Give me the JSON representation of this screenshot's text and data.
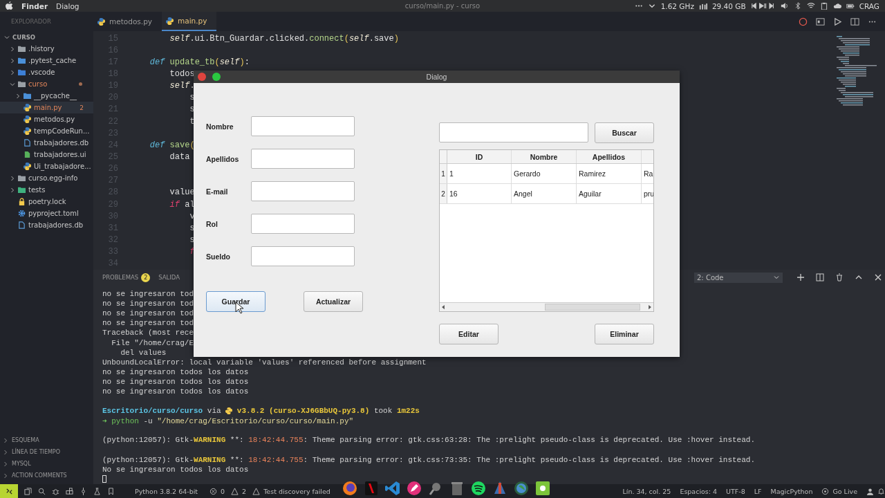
{
  "menubar": {
    "app": "Finder",
    "menus": [
      "Dialog"
    ],
    "title": "curso/main.py - curso",
    "cpu": "1.62 GHz",
    "memory": "29.40 GB",
    "user": "CRAG"
  },
  "sidebar": {
    "header": "EXPLORADOR",
    "tree": [
      {
        "label": "CURSO",
        "kind": "root",
        "expanded": true,
        "modified": false,
        "selected": false,
        "children": [
          {
            "label": ".history",
            "kind": "folder",
            "color": "#9aa0a6",
            "expanded": false,
            "modified": false,
            "selected": false
          },
          {
            "label": ".pytest_cache",
            "kind": "folder",
            "color": "#4a90d9",
            "expanded": false,
            "modified": false,
            "selected": false
          },
          {
            "label": ".vscode",
            "kind": "folder",
            "color": "#3d7fd6",
            "expanded": false,
            "modified": false,
            "selected": false
          },
          {
            "label": "curso",
            "kind": "folder",
            "color": "#9aa0a6",
            "expanded": true,
            "modified": true,
            "selected": false,
            "children": [
              {
                "label": "__pycache__",
                "kind": "folder",
                "color": "#4a90d9",
                "expanded": false,
                "modified": false,
                "selected": false
              },
              {
                "label": "main.py",
                "kind": "python",
                "modified": true,
                "badge": "2",
                "selected": true
              },
              {
                "label": "metodos.py",
                "kind": "python",
                "modified": false,
                "selected": false
              },
              {
                "label": "tempCodeRun...",
                "kind": "python",
                "modified": false,
                "selected": false
              },
              {
                "label": "trabajadores.db",
                "kind": "file",
                "modified": false,
                "selected": false
              },
              {
                "label": "trabajadores.ui",
                "kind": "ui",
                "modified": false,
                "selected": false
              },
              {
                "label": "Ui_trabajadore...",
                "kind": "python",
                "modified": false,
                "selected": false
              }
            ]
          },
          {
            "label": "curso.egg-info",
            "kind": "folder",
            "color": "#9aa0a6",
            "expanded": false,
            "modified": false,
            "selected": false
          },
          {
            "label": "tests",
            "kind": "folder",
            "color": "#3fb27f",
            "expanded": false,
            "modified": false,
            "selected": false
          },
          {
            "label": "poetry.lock",
            "kind": "lock",
            "modified": false,
            "selected": false
          },
          {
            "label": "pyproject.toml",
            "kind": "config",
            "modified": false,
            "selected": false
          },
          {
            "label": "trabajadores.db",
            "kind": "file",
            "modified": false,
            "selected": false
          }
        ]
      }
    ],
    "sections": [
      "ESQUEMA",
      "LÍNEA DE TIEMPO",
      "MYSQL",
      "ACTION COMMENTS"
    ]
  },
  "editor": {
    "tabs": [
      {
        "label": "metodos.py",
        "selected": false
      },
      {
        "label": "main.py",
        "selected": true
      }
    ],
    "lines": [
      {
        "number": "15",
        "tokens": [
          {
            "kind": "self",
            "text": "        self"
          },
          {
            "kind": "plain",
            "text": ".ui.Btn_Guardar.clicked."
          },
          {
            "kind": "fn",
            "text": "connect"
          },
          {
            "kind": "paren",
            "text": "("
          },
          {
            "kind": "self",
            "text": "self"
          },
          {
            "kind": "plain",
            "text": ".save"
          },
          {
            "kind": "paren",
            "text": ")"
          }
        ]
      },
      {
        "number": "16"
      },
      {
        "number": "17",
        "tokens": [
          {
            "kind": "def",
            "text": "    def"
          },
          {
            "kind": "fn",
            "text": " update_tb"
          },
          {
            "kind": "paren",
            "text": "("
          },
          {
            "kind": "self",
            "text": "self"
          },
          {
            "kind": "paren",
            "text": ")"
          },
          {
            "kind": "plain",
            "text": ":"
          }
        ]
      },
      {
        "number": "18",
        "tokens": [
          {
            "kind": "plain",
            "text": "        todos"
          }
        ]
      },
      {
        "number": "19",
        "tokens": [
          {
            "kind": "self",
            "text": "        self"
          },
          {
            "kind": "plain",
            "text": "."
          }
        ]
      },
      {
        "number": "20",
        "tokens": [
          {
            "kind": "plain",
            "text": "            s"
          }
        ]
      },
      {
        "number": "21",
        "tokens": [
          {
            "kind": "plain",
            "text": "            s"
          }
        ]
      },
      {
        "number": "22",
        "tokens": [
          {
            "kind": "plain",
            "text": "            t"
          }
        ]
      },
      {
        "number": "23"
      },
      {
        "number": "24",
        "tokens": [
          {
            "kind": "def",
            "text": "    def"
          },
          {
            "kind": "fn",
            "text": " save"
          },
          {
            "kind": "paren",
            "text": "("
          }
        ]
      },
      {
        "number": "25",
        "tokens": [
          {
            "kind": "plain",
            "text": "        data"
          }
        ]
      },
      {
        "number": "26"
      },
      {
        "number": "27"
      },
      {
        "number": "28",
        "tokens": [
          {
            "kind": "plain",
            "text": "        value"
          }
        ]
      },
      {
        "number": "29",
        "tokens": [
          {
            "kind": "ctrl",
            "text": "        if"
          },
          {
            "kind": "plain",
            "text": " al"
          }
        ]
      },
      {
        "number": "30",
        "tokens": [
          {
            "kind": "plain",
            "text": "            v"
          }
        ]
      },
      {
        "number": "31",
        "tokens": [
          {
            "kind": "plain",
            "text": "            s"
          }
        ]
      },
      {
        "number": "32",
        "tokens": [
          {
            "kind": "plain",
            "text": "            s"
          }
        ]
      },
      {
        "number": "33",
        "tokens": [
          {
            "kind": "ctrl",
            "text": "            f"
          }
        ]
      },
      {
        "number": "34"
      }
    ]
  },
  "panel": {
    "tabs": [
      {
        "label": "PROBLEMAS",
        "badge": "2"
      },
      {
        "label": "SALIDA"
      }
    ],
    "terminal_select": "2: Code",
    "lines": [
      {
        "kind": "text",
        "segments": [
          {
            "kind": "plain",
            "text": "no se ingresaron tod"
          }
        ]
      },
      {
        "kind": "text",
        "segments": [
          {
            "kind": "plain",
            "text": "no se ingresaron tod"
          }
        ]
      },
      {
        "kind": "text",
        "segments": [
          {
            "kind": "plain",
            "text": "no se ingresaron tod"
          }
        ]
      },
      {
        "kind": "text",
        "segments": [
          {
            "kind": "plain",
            "text": "no se ingresaron tod"
          }
        ]
      },
      {
        "kind": "text",
        "segments": [
          {
            "kind": "plain",
            "text": "Traceback (most rece"
          }
        ]
      },
      {
        "kind": "text",
        "segments": [
          {
            "kind": "plain",
            "text": "  File \"/home/crag/E"
          }
        ]
      },
      {
        "kind": "text",
        "segments": [
          {
            "kind": "plain",
            "text": "    del values"
          }
        ]
      },
      {
        "kind": "text",
        "segments": [
          {
            "kind": "plain",
            "text": "UnboundLocalError: local variable 'values' referenced before assignment"
          }
        ]
      },
      {
        "kind": "text",
        "segments": [
          {
            "kind": "plain",
            "text": "no se ingresaron todos los datos"
          }
        ]
      },
      {
        "kind": "text",
        "segments": [
          {
            "kind": "plain",
            "text": "no se ingresaron todos los datos"
          }
        ]
      },
      {
        "kind": "text",
        "segments": [
          {
            "kind": "plain",
            "text": "no se ingresaron todos los datos"
          }
        ]
      },
      {
        "kind": "blank"
      },
      {
        "kind": "text",
        "segments": [
          {
            "kind": "path",
            "text": "Escritorio/curso/curso"
          },
          {
            "kind": "plain",
            "text": " via "
          },
          {
            "kind": "icon"
          },
          {
            "kind": "version",
            "text": " v3.8.2 (curso-XJ6GBbUQ-py3.8)"
          },
          {
            "kind": "plain",
            "text": " took "
          },
          {
            "kind": "version",
            "text": "1m22s"
          }
        ]
      },
      {
        "kind": "text",
        "segments": [
          {
            "kind": "arrow",
            "text": "➜"
          },
          {
            "kind": "cmd",
            "text": " python"
          },
          {
            "kind": "plain",
            "text": " -u "
          },
          {
            "kind": "str",
            "text": "\"/home/crag/Escritorio/curso/curso/main.py\""
          }
        ]
      },
      {
        "kind": "blank"
      },
      {
        "kind": "text",
        "segments": [
          {
            "kind": "plain",
            "text": "(python:12057): Gtk-"
          },
          {
            "kind": "warn",
            "text": "WARNING"
          },
          {
            "kind": "plain",
            "text": " **: "
          },
          {
            "kind": "time",
            "text": "18:42:44.755"
          },
          {
            "kind": "plain",
            "text": ": Theme parsing error: gtk.css:63:28: The :prelight pseudo-class is deprecated. Use :hover instead."
          }
        ]
      },
      {
        "kind": "blank"
      },
      {
        "kind": "text",
        "segments": [
          {
            "kind": "plain",
            "text": "(python:12057): Gtk-"
          },
          {
            "kind": "warn",
            "text": "WARNING"
          },
          {
            "kind": "plain",
            "text": " **: "
          },
          {
            "kind": "time",
            "text": "18:42:44.755"
          },
          {
            "kind": "plain",
            "text": ": Theme parsing error: gtk.css:73:35: The :prelight pseudo-class is deprecated. Use :hover instead."
          }
        ]
      },
      {
        "kind": "text",
        "segments": [
          {
            "kind": "plain",
            "text": "No se ingresaron todos los datos"
          }
        ]
      },
      {
        "kind": "cursor"
      }
    ]
  },
  "dialog": {
    "title": "Dialog",
    "fields": [
      {
        "label": "Nombre"
      },
      {
        "label": "Apellidos"
      },
      {
        "label": "E-mail"
      },
      {
        "label": "Rol"
      },
      {
        "label": "Sueldo"
      }
    ],
    "buttons": [
      {
        "label": "Guardar",
        "focused": true
      },
      {
        "label": "Actualizar",
        "focused": false
      }
    ],
    "search_button": "Buscar",
    "table": {
      "columns": [
        "ID",
        "Nombre",
        "Apellidos"
      ],
      "rows": [
        {
          "header": "1",
          "cells": [
            "1",
            "Gerardo",
            "Ramirez",
            "Ra"
          ]
        },
        {
          "header": "2",
          "cells": [
            "16",
            "Angel",
            "Aguilar",
            "pru"
          ]
        }
      ]
    },
    "actions": [
      "Editar",
      "Eliminar"
    ]
  },
  "status_bar": {
    "language": "Python 3.8.2 64-bit",
    "errors": "0",
    "warnings": "2",
    "tests": "Test discovery failed",
    "right": [
      "Lín. 34, col. 25",
      "Espacios: 4",
      "UTF-8",
      "LF",
      "MagicPython"
    ],
    "live": "Go Live"
  }
}
